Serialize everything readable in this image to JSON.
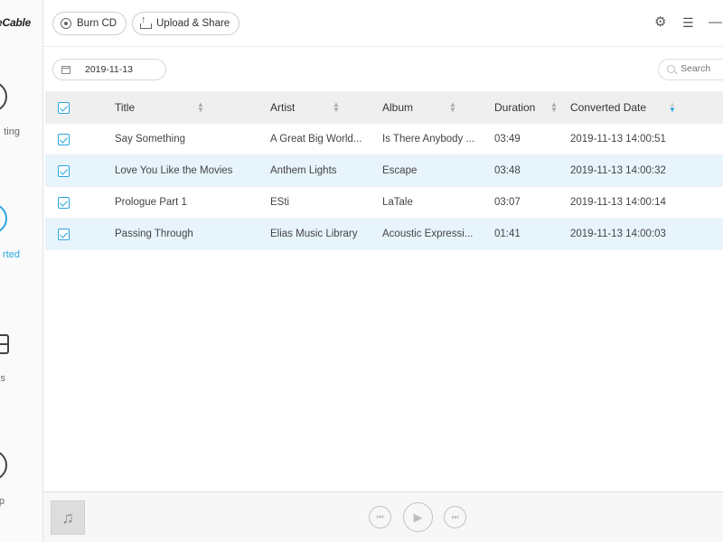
{
  "app": {
    "logo_text": "eCable"
  },
  "sidebar": {
    "items": [
      {
        "label": "ting",
        "icon": "converting-icon",
        "active": false
      },
      {
        "label": "rted",
        "icon": "converted-icon",
        "active": true
      },
      {
        "label": "s",
        "icon": "tools-icon",
        "active": false
      },
      {
        "label": "p",
        "icon": "help-icon",
        "active": false
      }
    ]
  },
  "toolbar": {
    "burn_label": "Burn CD",
    "upload_label": "Upload & Share",
    "settings_icon": "gear-icon",
    "menu_icon": "hamburger-menu-icon",
    "minimize_icon": "minimize-icon"
  },
  "filter": {
    "date": "2019-11-13",
    "search_placeholder": "Search"
  },
  "table": {
    "headers": {
      "title": "Title",
      "artist": "Artist",
      "album": "Album",
      "duration": "Duration",
      "converted_date": "Converted Date"
    },
    "sorted_column": "converted_date",
    "rows": [
      {
        "title": "Say Something",
        "artist": "A Great Big World...",
        "album": "Is There Anybody ...",
        "duration": "03:49",
        "converted_date": "2019-11-13 14:00:51",
        "checked": true
      },
      {
        "title": "Love You Like the Movies",
        "artist": "Anthem Lights",
        "album": "Escape",
        "duration": "03:48",
        "converted_date": "2019-11-13 14:00:32",
        "checked": true
      },
      {
        "title": "Prologue Part 1",
        "artist": "ESti",
        "album": "LaTale",
        "duration": "03:07",
        "converted_date": "2019-11-13 14:00:14",
        "checked": true
      },
      {
        "title": "Passing Through",
        "artist": "Elias Music Library",
        "album": "Acoustic Expressi...",
        "duration": "01:41",
        "converted_date": "2019-11-13 14:00:03",
        "checked": true
      }
    ]
  },
  "player": {
    "art_icon": "music-note-icon",
    "prev_icon": "previous-icon",
    "play_icon": "play-icon",
    "next_icon": "next-icon"
  },
  "colors": {
    "accent": "#2aa6df",
    "row_highlight": "#e7f4fc",
    "header_bg": "#efefef"
  }
}
